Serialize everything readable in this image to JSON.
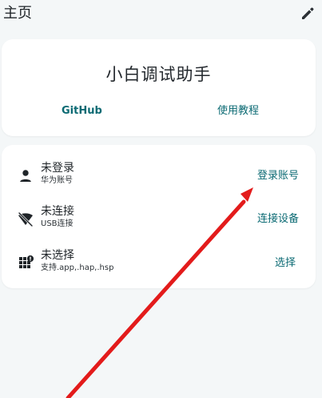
{
  "header": {
    "title": "主页",
    "edit_icon": "pencil-icon"
  },
  "hero": {
    "title": "小白调试助手",
    "github_label": "GitHub",
    "tutorial_label": "使用教程"
  },
  "status_list": {
    "items": [
      {
        "icon": "person-icon",
        "title": "未登录",
        "subtitle": "华为账号",
        "action": "登录账号"
      },
      {
        "icon": "no-signal-icon",
        "title": "未连接",
        "subtitle": "USB连接",
        "action": "连接设备"
      },
      {
        "icon": "apps-alert-icon",
        "title": "未选择",
        "subtitle": "支持.app,.hap,.hsp",
        "action": "选择"
      }
    ]
  },
  "annotation": {
    "arrow_color": "#e31b1b"
  },
  "colors": {
    "background": "#f4f7f8",
    "accent": "#0b6a73",
    "card": "#ffffff"
  }
}
